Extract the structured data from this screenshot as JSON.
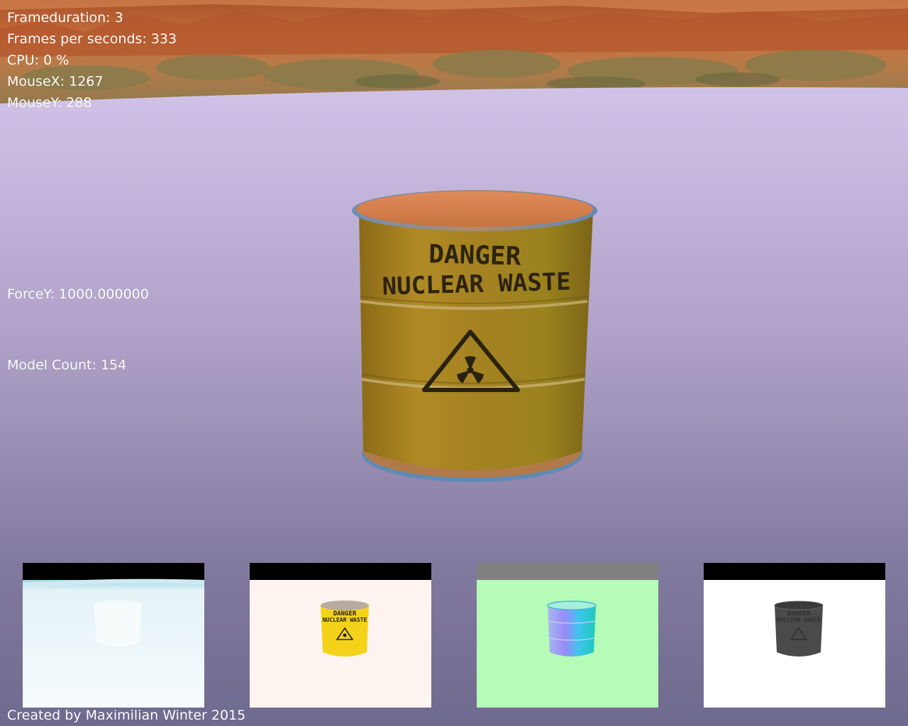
{
  "hud": {
    "frameduration": "Frameduration: 3",
    "fps": "Frames per seconds: 333",
    "cpu": "CPU: 0 %",
    "mouse_x": "MouseX: 1267",
    "mouse_y": "MouseY: 288",
    "force_y": "ForceY: 1000.000000",
    "model_count": "Model Count: 154"
  },
  "barrel": {
    "label_line1": "DANGER",
    "label_line2": "NUCLEAR WASTE",
    "body_color": "#9a7a1a",
    "icon": "radiation-warning-icon"
  },
  "gbuffer_previews": [
    {
      "name": "depth-buffer-preview",
      "bg": "#f0fafc"
    },
    {
      "name": "albedo-buffer-preview",
      "bg": "#fdf4ef"
    },
    {
      "name": "normal-buffer-preview",
      "bg": "#b4fcb8"
    },
    {
      "name": "specular-buffer-preview",
      "bg": "#ffffff"
    }
  ],
  "thumb_label_line1": "DANGER",
  "thumb_label_line2": "NUCLEAR WASTE",
  "footer": {
    "credit": "Created by Maximilian Winter 2015"
  },
  "colors": {
    "floor_top": "#cfc0e4",
    "floor_bottom": "#6f6a8f",
    "sky_orange": "#c56a35"
  }
}
